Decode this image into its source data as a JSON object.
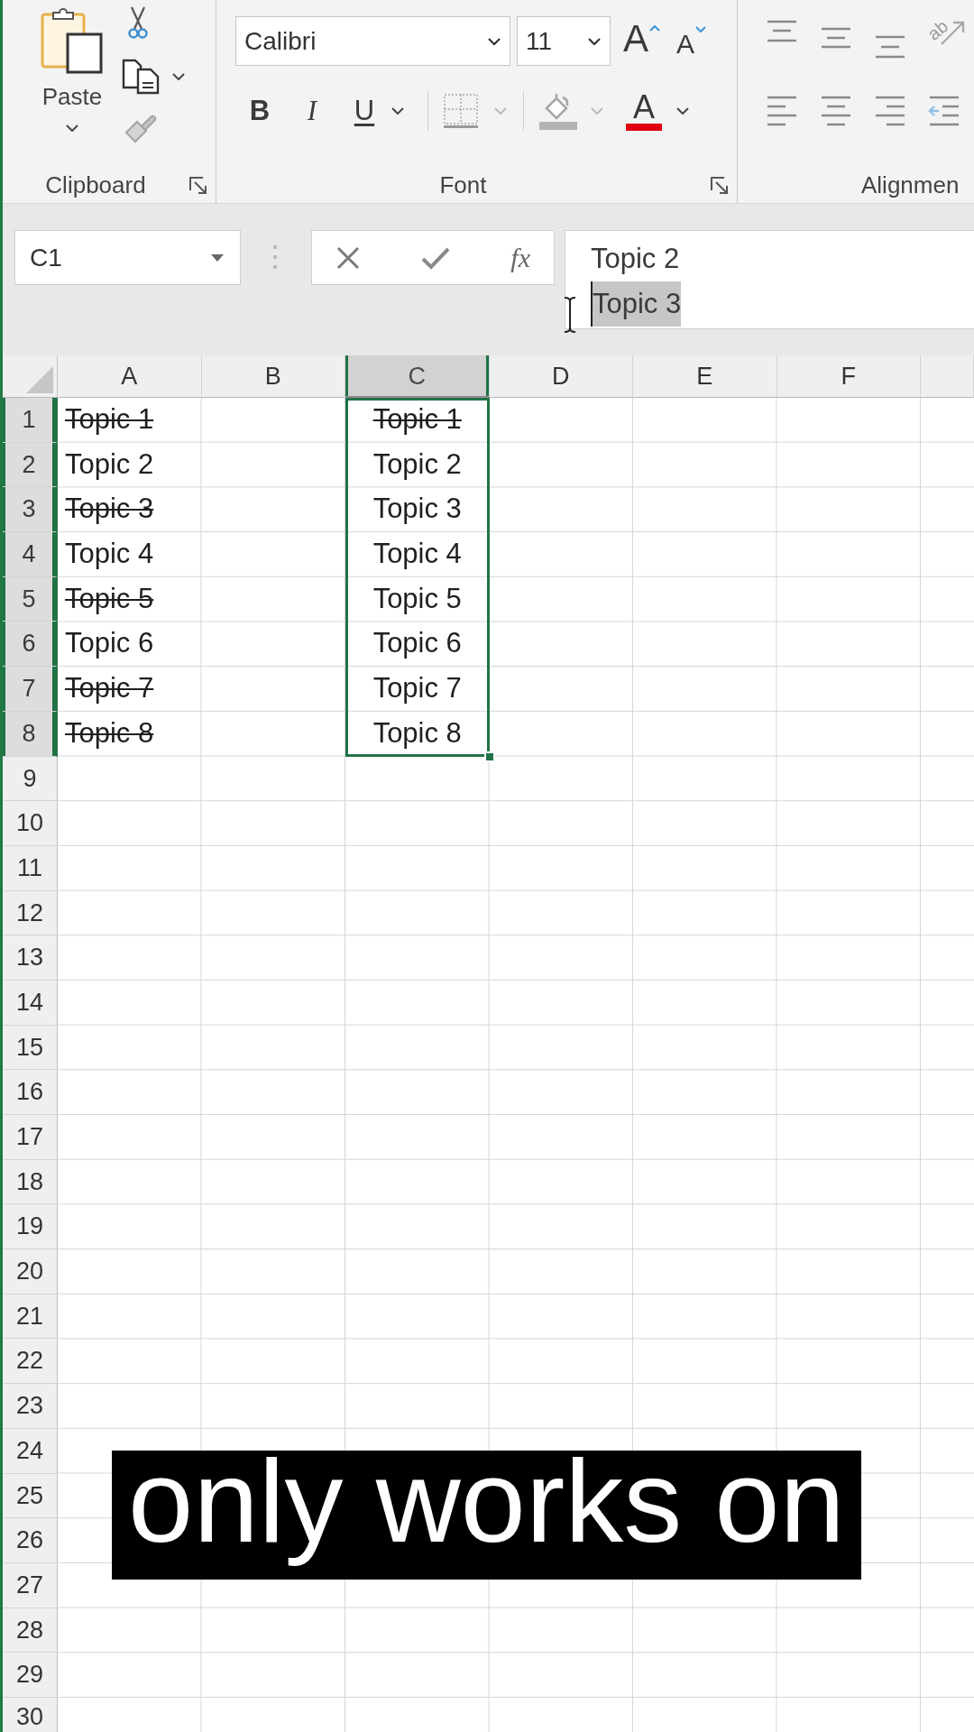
{
  "ribbon": {
    "groups": [
      {
        "kind": "clipboard",
        "label": "Clipboard",
        "paste_label": "Paste"
      },
      {
        "kind": "font",
        "label": "Font",
        "font_name": "Calibri",
        "font_size": "11",
        "grow_label": "A",
        "shrink_label": "A",
        "style_buttons": [
          {
            "kind": "bold",
            "label": "B"
          },
          {
            "kind": "italic",
            "label": "I"
          },
          {
            "kind": "underline",
            "label": "U"
          }
        ],
        "font_color_label": "A"
      },
      {
        "kind": "alignment",
        "label": "Alignmen",
        "orientation_label": "ab"
      }
    ]
  },
  "formula_bar": {
    "name_box": "C1",
    "function_label": "fx",
    "lines": [
      {
        "text": "Topic 2",
        "selected": false
      },
      {
        "text": "Topic 3",
        "selected": true
      }
    ]
  },
  "sheet": {
    "columns": [
      {
        "label": "A",
        "selected": false,
        "centered": false,
        "cells": [
          {
            "text": "Topic 1",
            "strikethrough": true
          },
          {
            "text": "Topic 2",
            "strikethrough": false
          },
          {
            "text": "Topic 3",
            "strikethrough": true
          },
          {
            "text": "Topic 4",
            "strikethrough": false
          },
          {
            "text": "Topic 5",
            "strikethrough": true
          },
          {
            "text": "Topic 6",
            "strikethrough": false
          },
          {
            "text": "Topic 7",
            "strikethrough": true
          },
          {
            "text": "Topic 8",
            "strikethrough": true
          }
        ]
      },
      {
        "label": "B",
        "selected": false
      },
      {
        "label": "C",
        "selected": true,
        "centered": true,
        "cells": [
          {
            "text": "Topic 1",
            "strikethrough": true
          },
          {
            "text": "Topic 2",
            "strikethrough": false
          },
          {
            "text": "Topic 3",
            "strikethrough": false
          },
          {
            "text": "Topic 4",
            "strikethrough": false
          },
          {
            "text": "Topic 5",
            "strikethrough": false
          },
          {
            "text": "Topic 6",
            "strikethrough": false
          },
          {
            "text": "Topic 7",
            "strikethrough": false
          },
          {
            "text": "Topic 8",
            "strikethrough": false
          }
        ]
      },
      {
        "label": "D",
        "selected": false
      },
      {
        "label": "E",
        "selected": false
      },
      {
        "label": "F",
        "selected": false
      }
    ],
    "rows": [
      {
        "label": "1",
        "selected": true
      },
      {
        "label": "2",
        "selected": true
      },
      {
        "label": "3",
        "selected": true
      },
      {
        "label": "4",
        "selected": true
      },
      {
        "label": "5",
        "selected": true
      },
      {
        "label": "6",
        "selected": true
      },
      {
        "label": "7",
        "selected": true
      },
      {
        "label": "8",
        "selected": true
      },
      {
        "label": "9",
        "selected": false
      },
      {
        "label": "10",
        "selected": false
      },
      {
        "label": "11",
        "selected": false
      },
      {
        "label": "12",
        "selected": false
      },
      {
        "label": "13",
        "selected": false
      },
      {
        "label": "14",
        "selected": false
      },
      {
        "label": "15",
        "selected": false
      },
      {
        "label": "16",
        "selected": false
      },
      {
        "label": "17",
        "selected": false
      },
      {
        "label": "18",
        "selected": false
      },
      {
        "label": "19",
        "selected": false
      },
      {
        "label": "20",
        "selected": false
      },
      {
        "label": "21",
        "selected": false
      },
      {
        "label": "22",
        "selected": false
      },
      {
        "label": "23",
        "selected": false
      },
      {
        "label": "24",
        "selected": false
      },
      {
        "label": "25",
        "selected": false
      },
      {
        "label": "26",
        "selected": false
      },
      {
        "label": "27",
        "selected": false
      },
      {
        "label": "28",
        "selected": false
      },
      {
        "label": "29",
        "selected": false
      },
      {
        "label": "30",
        "selected": false
      }
    ]
  },
  "caption": "only works on"
}
